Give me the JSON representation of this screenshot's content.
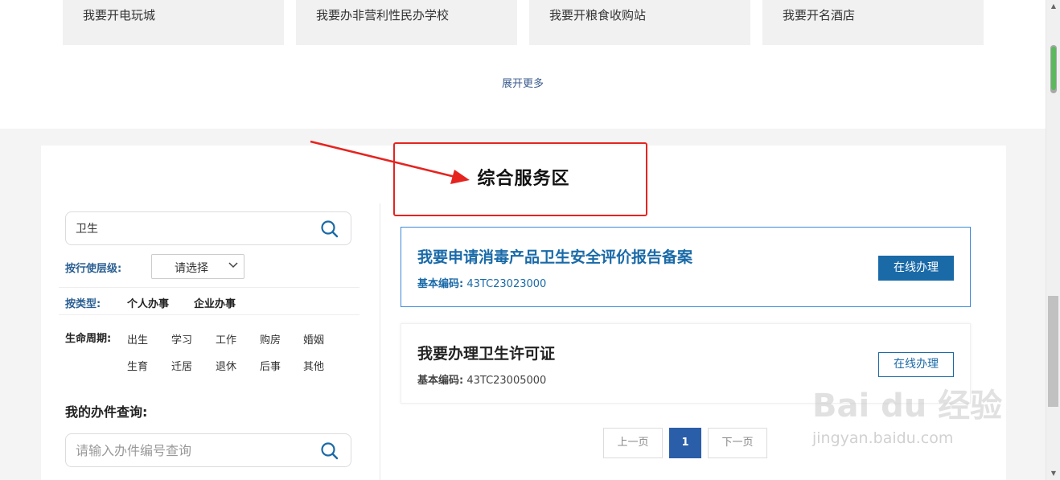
{
  "top_cards": [
    {
      "label": "我要开电玩城"
    },
    {
      "label": "我要办非营利性民办学校"
    },
    {
      "label": "我要开粮食收购站"
    },
    {
      "label": "我要开名酒店"
    }
  ],
  "expand_more": "展开更多",
  "service_area_title": "综合服务区",
  "search": {
    "value": "卫生"
  },
  "filters": {
    "level_label": "按行使层级:",
    "level_select_value": "请选择",
    "type_label": "按类型:",
    "type_options": [
      "个人办事",
      "企业办事"
    ],
    "life_label": "生命周期:",
    "life_items": [
      "出生",
      "学习",
      "工作",
      "购房",
      "婚姻",
      "生育",
      "迁居",
      "退休",
      "后事",
      "其他"
    ]
  },
  "query": {
    "title": "我的办件查询:",
    "placeholder": "请输入办件编号查询"
  },
  "items": [
    {
      "title": "我要申请消毒产品卫生安全评价报告备案",
      "code_label": "基本编码:",
      "code": "43TC23023000",
      "button": "在线办理"
    },
    {
      "title": "我要办理卫生许可证",
      "code_label": "基本编码:",
      "code": "43TC23005000",
      "button": "在线办理"
    }
  ],
  "pagination": {
    "prev": "上一页",
    "current": "1",
    "next": "下一页"
  },
  "watermark": {
    "logo": "Bai du 经验",
    "url": "jingyan.baidu.com"
  },
  "colors": {
    "accent_blue": "#1a6aa8",
    "annotation_red": "#e52420",
    "page_current": "#2b5ea8"
  }
}
